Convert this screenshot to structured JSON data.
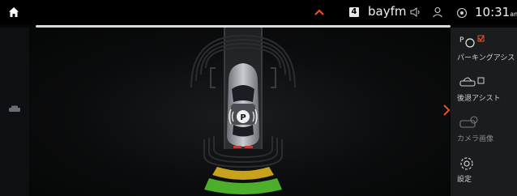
{
  "status_bar": {
    "station_number": "4",
    "station_name": "bayfm",
    "time": "10:31",
    "ampm": "am"
  },
  "side_panel": {
    "items": [
      {
        "label": "パーキングアシス",
        "icon": "parking-assist-icon",
        "checked": true,
        "active": true
      },
      {
        "label": "後退アシスト",
        "icon": "reverse-assist-icon",
        "checked": false,
        "active": true
      },
      {
        "label": "カメラ画像",
        "icon": "camera-view-icon",
        "checked": false,
        "active": false
      },
      {
        "label": "設定",
        "icon": "settings-icon",
        "checked": false,
        "active": true
      }
    ]
  },
  "colors": {
    "accent": "#e8502a",
    "sensor_yellow": "#c8a21a",
    "sensor_green": "#4cae2a",
    "track": "#2a2d30"
  }
}
